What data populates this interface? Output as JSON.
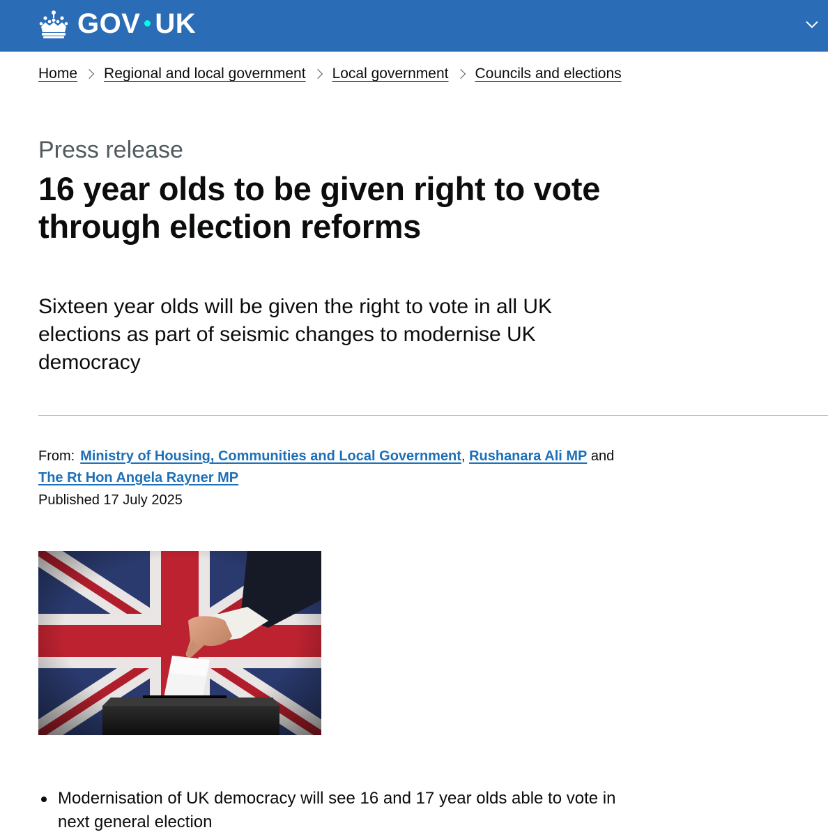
{
  "header": {
    "logo_gov": "GOV",
    "logo_uk": "UK",
    "crown_icon": "crown-icon",
    "menu_icon": "chevron-down-icon",
    "background_color": "#2b6cb7"
  },
  "breadcrumbs": [
    {
      "label": "Home"
    },
    {
      "label": "Regional and local government"
    },
    {
      "label": "Local government"
    },
    {
      "label": "Councils and elections"
    }
  ],
  "article": {
    "caption": "Press release",
    "title": "16 year olds to be given right to vote through election reforms",
    "lead": "Sixteen year olds will be given the right to vote in all UK elections as part of seismic changes to modernise UK democracy",
    "from_label": "From:",
    "from_orgs": [
      "Ministry of Housing, Communities and Local Government",
      "Rushanara Ali MP",
      "The Rt Hon Angela Rayner MP"
    ],
    "from_sep": ",",
    "from_and": "and",
    "published": "Published 17 July 2025",
    "bullets": [
      "Modernisation of UK democracy will see 16 and 17 year olds able to vote in next general election"
    ]
  },
  "colors": {
    "link": "#1d70b8",
    "text": "#0b0c0c",
    "secondary_text": "#505a5f"
  }
}
